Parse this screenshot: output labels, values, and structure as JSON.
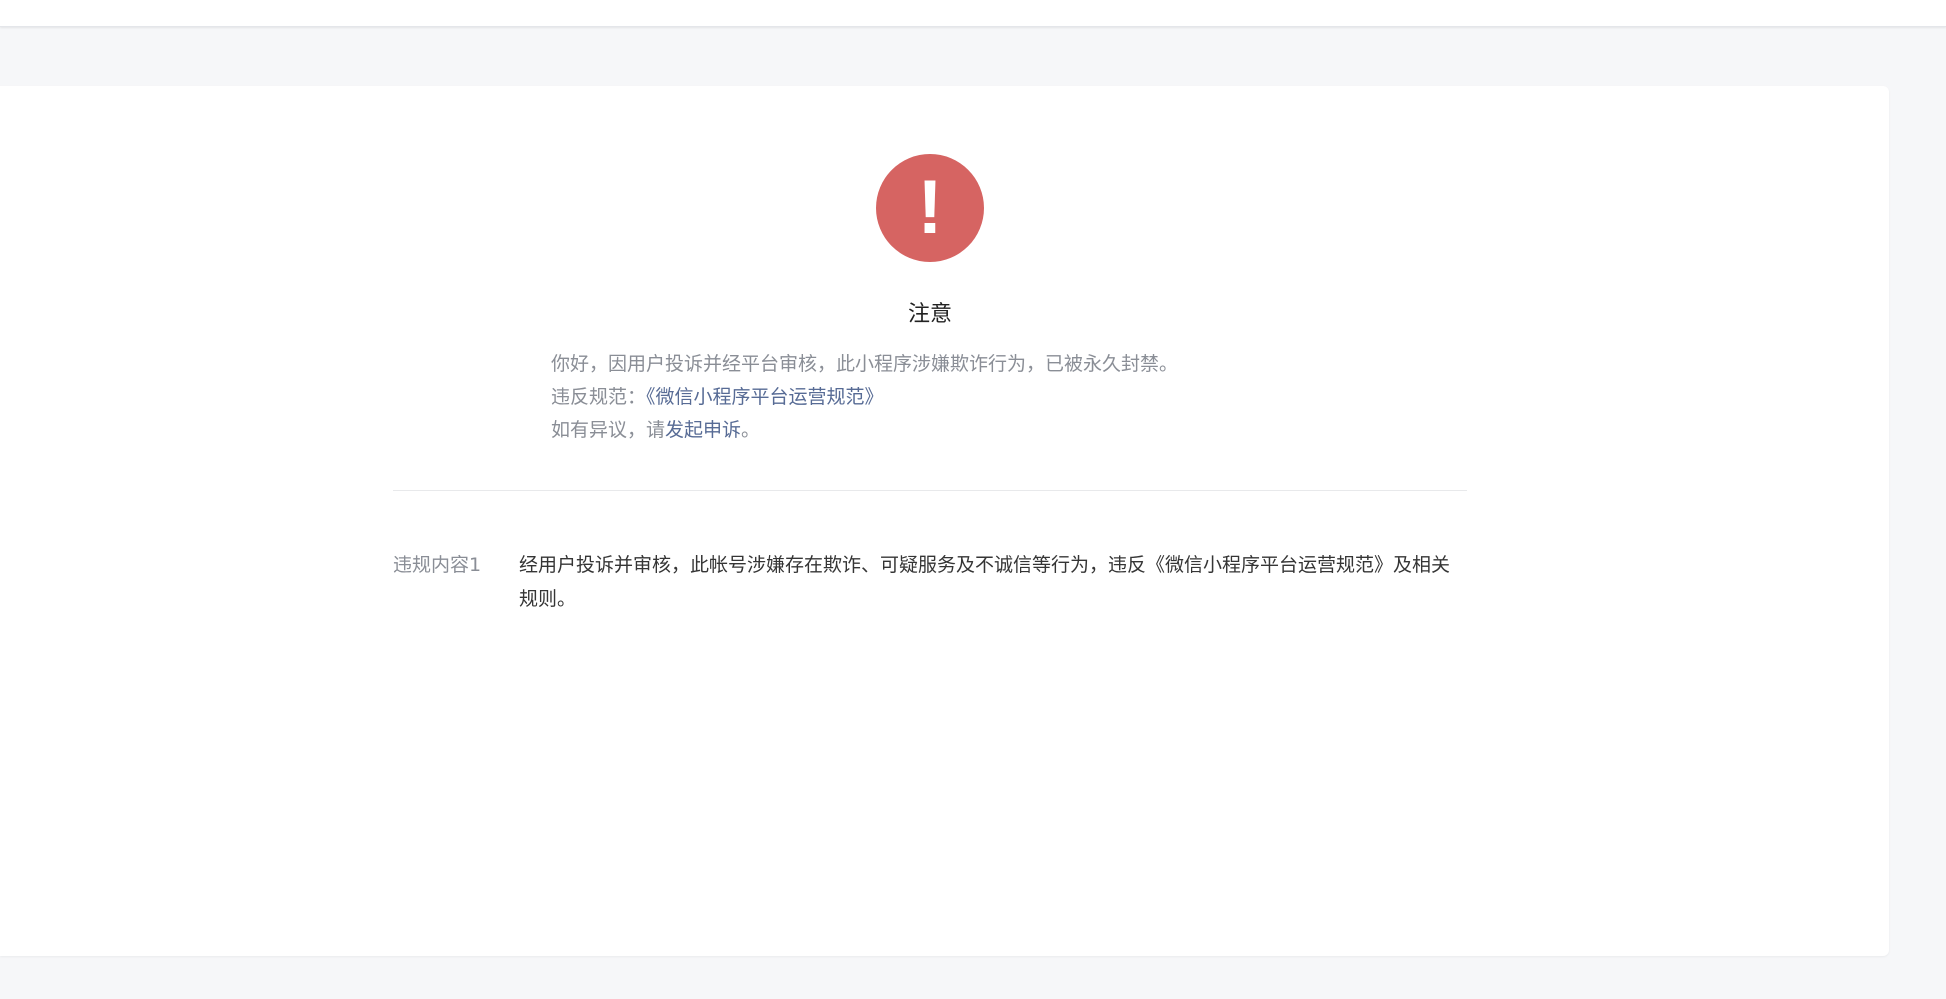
{
  "notice": {
    "icon_char": "!",
    "icon_color": "#d66462",
    "title": "注意",
    "message": "你好，因用户投诉并经平台审核，此小程序涉嫌欺诈行为，已被永久封禁。",
    "rule_prefix": "违反规范：",
    "rule_link": "《微信小程序平台运营规范》",
    "appeal_prefix": "如有异议，请",
    "appeal_link": "发起申诉",
    "appeal_suffix": "。"
  },
  "violation": {
    "label": "违规内容1",
    "text": "经用户投诉并审核，此帐号涉嫌存在欺诈、可疑服务及不诚信等行为，违反《微信小程序平台运营规范》及相关规则。"
  },
  "colors": {
    "link": "#576b95",
    "page_bg": "#f6f7f9"
  }
}
